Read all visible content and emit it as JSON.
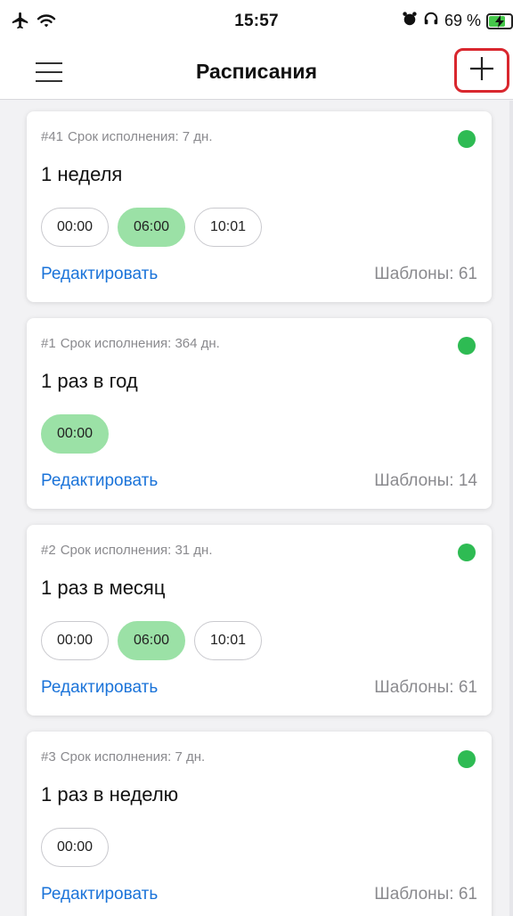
{
  "status_bar": {
    "time": "15:57",
    "battery_text": "69 %",
    "battery_level": 0.69
  },
  "nav": {
    "title": "Расписания"
  },
  "schedules": [
    {
      "id": "#41",
      "deadline": "Срок исполнения: 7 дн.",
      "title": "1 неделя",
      "times": [
        {
          "label": "00:00",
          "active": false
        },
        {
          "label": "06:00",
          "active": true
        },
        {
          "label": "10:01",
          "active": false
        }
      ],
      "edit_label": "Редактировать",
      "templates": "Шаблоны: 61"
    },
    {
      "id": "#1",
      "deadline": "Срок исполнения: 364 дн.",
      "title": "1 раз в год",
      "times": [
        {
          "label": "00:00",
          "active": true
        }
      ],
      "edit_label": "Редактировать",
      "templates": "Шаблоны: 14"
    },
    {
      "id": "#2",
      "deadline": "Срок исполнения: 31 дн.",
      "title": "1 раз в месяц",
      "times": [
        {
          "label": "00:00",
          "active": false
        },
        {
          "label": "06:00",
          "active": true
        },
        {
          "label": "10:01",
          "active": false
        }
      ],
      "edit_label": "Редактировать",
      "templates": "Шаблоны: 61"
    },
    {
      "id": "#3",
      "deadline": "Срок исполнения: 7 дн.",
      "title": "1 раз в неделю",
      "times": [
        {
          "label": "00:00",
          "active": false
        }
      ],
      "edit_label": "Редактировать",
      "templates": "Шаблоны: 61"
    }
  ],
  "colors": {
    "accent_link": "#1a73d9",
    "active_chip": "#9be1a6",
    "status_dot": "#2ebb53",
    "add_button_highlight": "#d9272e"
  },
  "icons": {
    "airplane": "airplane-icon",
    "wifi": "wifi-icon",
    "alarm": "alarm-icon",
    "headphones": "headphones-icon",
    "battery": "battery-charging-icon",
    "menu": "hamburger-menu-icon",
    "add": "plus-icon"
  }
}
